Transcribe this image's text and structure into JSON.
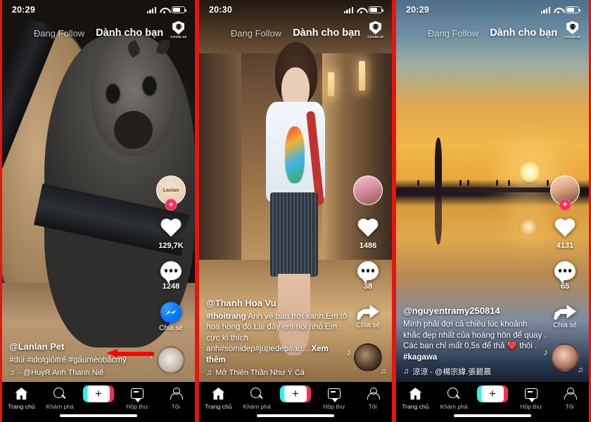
{
  "app": {
    "name": "TikTok",
    "brand_pink": "#fe2c55",
    "brand_cyan": "#25f4ee",
    "annotation_color": "#fe0000"
  },
  "panels": [
    {
      "status": {
        "clock": "20:29"
      },
      "topnav": {
        "following_tab": "Đang Follow",
        "foryou_tab": "Dành cho bạn",
        "covid_label": "COVID-19"
      },
      "rail": {
        "avatar_label": "Lanlan",
        "follow_plus": "+",
        "like_count": "129,7K",
        "comment_count": "1248",
        "share_label": "Chia sẻ",
        "share_icon": "messenger-icon"
      },
      "caption": {
        "username": "@Lanlan Pet",
        "text": "#dúi #idolgiỏitrẻ #gấumèobắcmỹ",
        "music": "- @HuyR   Anh Thanh Niê"
      }
    },
    {
      "status": {
        "clock": "20:30"
      },
      "topnav": {
        "following_tab": "Đang Follow",
        "foryou_tab": "Dành cho bạn",
        "covid_label": "COVID-19"
      },
      "rail": {
        "avatar_label": "",
        "follow_plus": "",
        "like_count": "1486",
        "comment_count": "38",
        "share_label": "Chia sẻ",
        "share_icon": "share-arrow-icon"
      },
      "caption": {
        "username": "@Thanh Hoa Vu",
        "hashtag_lead": "#thoitrang",
        "text": " Anh về bầu trời xanh.Em tô hoa hồng đỏ.Lại đây em nói nhỏ.Em cực kì thích anh#somidep#jupedep#ao...",
        "more_label": "Xem thêm",
        "music": "Mở Thiên Thần   Như Ý Cá"
      }
    },
    {
      "status": {
        "clock": "20:29"
      },
      "topnav": {
        "following_tab": "Đang Follow",
        "foryou_tab": "Dành cho bạn",
        "covid_label": "COVID-19"
      },
      "rail": {
        "avatar_label": "",
        "follow_plus": "+",
        "like_count": "4131",
        "comment_count": "65",
        "share_label": "Chia sẻ",
        "share_icon": "share-arrow-icon"
      },
      "caption": {
        "username": "@nguyentramy250814",
        "text": "Mình phải đợi cả chiều lúc khoảnh khắc đẹp nhất của hoàng hôn để quay . Các bạn chỉ mất 0,5s để thả ❤️ thôi .",
        "hashtag_tail": "#kagawa",
        "music": "涼涼 - @楊宗緯.張碧晨"
      }
    }
  ],
  "bottomnav": {
    "items": [
      {
        "label": "Trang chủ",
        "icon": "home-icon"
      },
      {
        "label": "Khám phá",
        "icon": "search-icon"
      },
      {
        "label": "+",
        "icon": "create-plus-icon"
      },
      {
        "label": "Hộp thư",
        "icon": "inbox-icon"
      },
      {
        "label": "Tôi",
        "icon": "profile-icon"
      }
    ]
  }
}
